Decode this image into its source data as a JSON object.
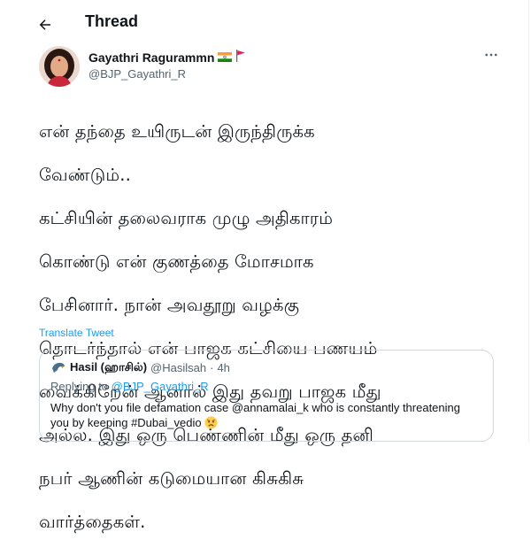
{
  "header": {
    "title": "Thread",
    "back_icon": "arrow-left-icon"
  },
  "author": {
    "display_name": "Gayathri Ragurammn",
    "handle": "@BJP_Gayathri_R",
    "badges": [
      "india-flag-icon",
      "red-flag-icon"
    ]
  },
  "tweet": {
    "lines": [
      "என் தந்தை உயிருடன் இருந்திருக்க",
      "வேண்டும்..",
      "கட்சியின் தலைவராக முழு அதிகாரம்",
      "கொண்டு என் குணத்தை மோசமாக",
      "பேசினார். நான் அவதூறு வழக்கு",
      "தொடர்ந்தால் என் பாஜக கட்சியை பணயம்",
      "வைக்கிறேன் ஆனால் இது தவறு பாஜக மீது",
      "அல்ல. இது ஒரு பெண்ணின் மீது ஒரு தனி",
      "நபர் ஆணின் கடுமையான கிசுகிசு",
      "வார்த்தைகள்."
    ],
    "translate_label": "Translate Tweet"
  },
  "quote": {
    "name": "Hasil (ஹாசில்)",
    "handle": "@Hasilsah",
    "separator": "·",
    "time": "4h",
    "replying_prefix": "Replying to",
    "replying_to": "@BJP_Gayathri_R",
    "body_line1": "Why don't you file defamation case @annamalai_k who is constantly threatening",
    "body_line2": "you by keeping #Dubai_vedio",
    "emoji": "worried-face-emoji"
  },
  "colors": {
    "accent": "#1d9bf0",
    "muted": "#536471",
    "text": "#0f1419",
    "border": "#cfd9de"
  }
}
